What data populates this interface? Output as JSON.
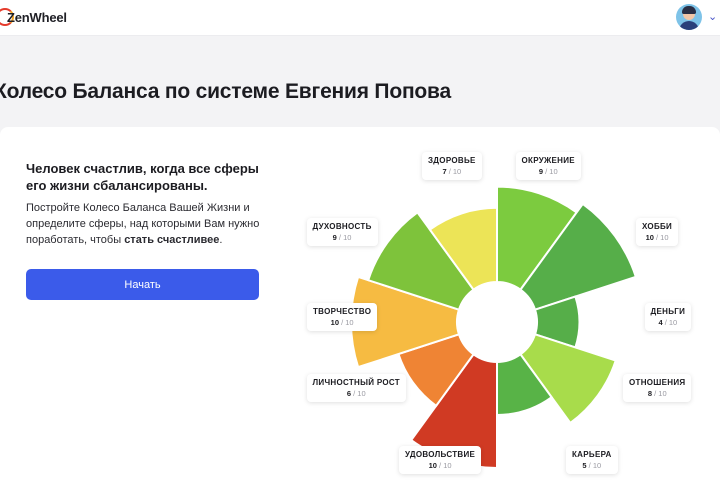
{
  "app": {
    "brand": "ZenWheel"
  },
  "page": {
    "title": "Колесо Баланса по системе Евгения Попова"
  },
  "intro": {
    "lead": "Человек счастлив, когда все сферы его жизни сбалансированы.",
    "desc_part1": "Постройте Колесо Баланса Вашей Жизни и определите сферы, над которыми Вам нужно поработать, чтобы ",
    "desc_bold": "стать счастливее",
    "desc_end": "."
  },
  "buttons": {
    "start_label": "Начать"
  },
  "wheel": {
    "max": 10,
    "scale_suffix": " / 10",
    "spheres": [
      {
        "id": "okruzhenie",
        "name": "ОКРУЖЕНИЕ",
        "score": 9,
        "color": "#7ccb3f"
      },
      {
        "id": "hobbi",
        "name": "ХОББИ",
        "score": 10,
        "color": "#56ae49"
      },
      {
        "id": "dengi",
        "name": "ДЕНЬГИ",
        "score": 4,
        "color": "#56ae49"
      },
      {
        "id": "otnosheniya",
        "name": "ОТНОШЕНИЯ",
        "score": 8,
        "color": "#a8dc4b"
      },
      {
        "id": "karera",
        "name": "КАРЬЕРА",
        "score": 5,
        "color": "#58b347"
      },
      {
        "id": "udovolstvie",
        "name": "УДОВОЛЬСТВИЕ",
        "score": 10,
        "color": "#d03a23"
      },
      {
        "id": "lichnostnyi-rost",
        "name": "ЛИЧНОСТНЫЙ РОСТ",
        "score": 6,
        "color": "#ef8434"
      },
      {
        "id": "tvorchestvo",
        "name": "ТВОРЧЕСТВО",
        "score": 10,
        "color": "#f6bb42"
      },
      {
        "id": "duhovnost",
        "name": "ДУХОВНОСТЬ",
        "score": 9,
        "color": "#7ec33b"
      },
      {
        "id": "zdorove",
        "name": "ЗДОРОВЬЕ",
        "score": 7,
        "color": "#ece457"
      }
    ]
  }
}
